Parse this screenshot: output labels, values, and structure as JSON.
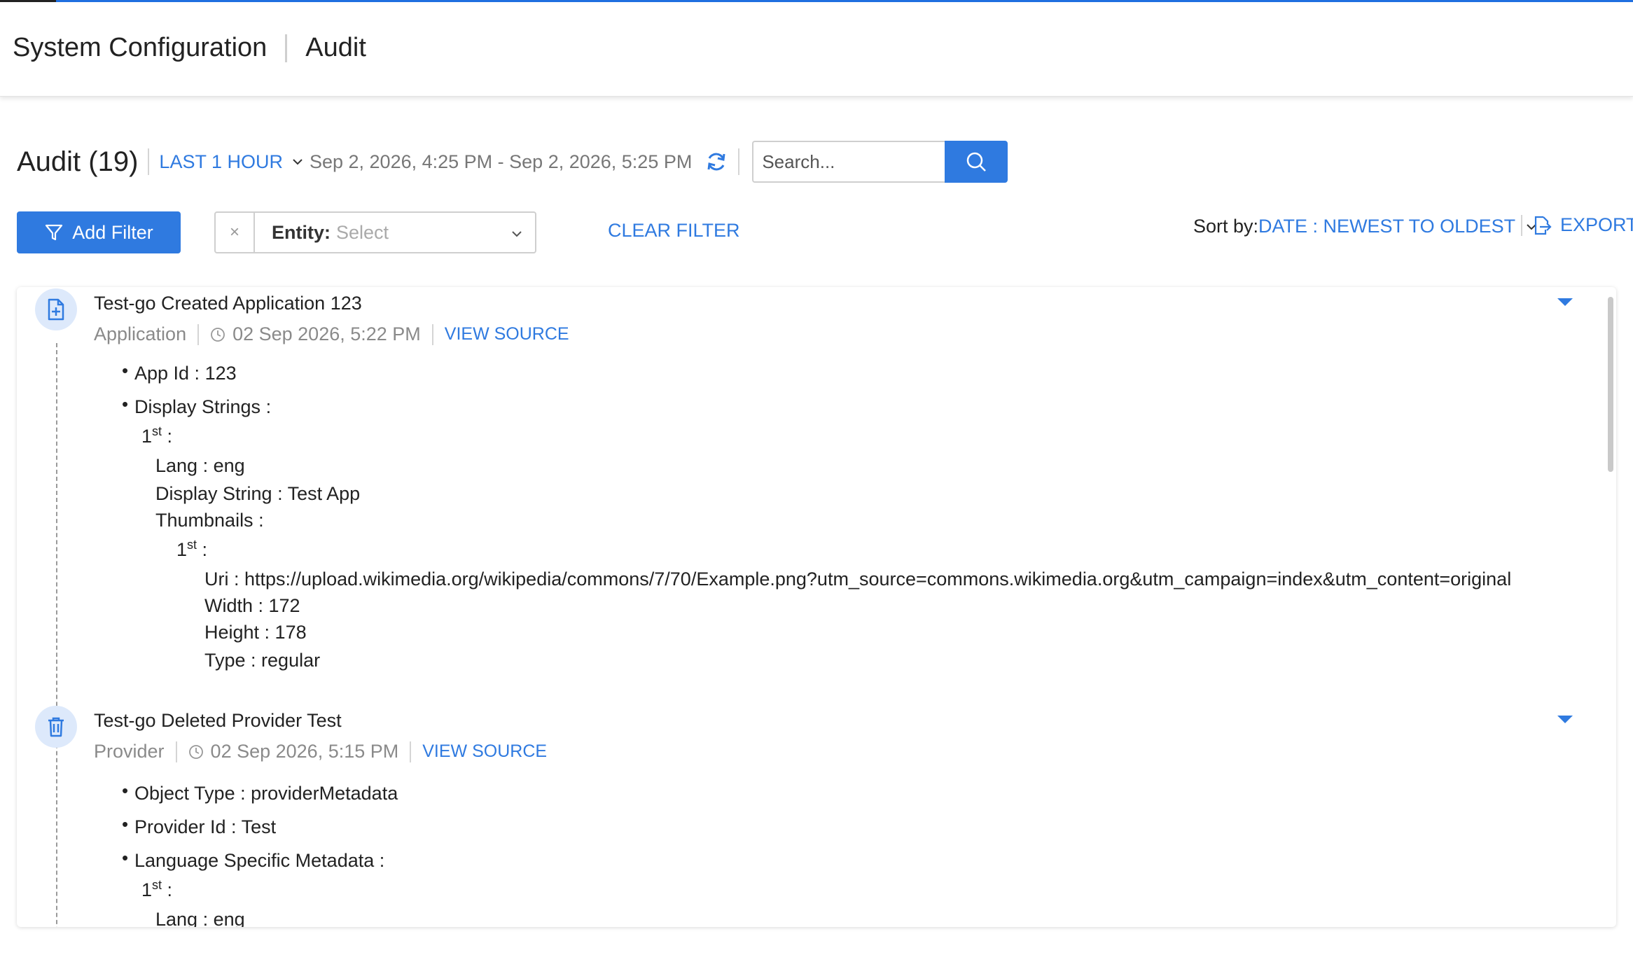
{
  "header": {
    "breadcrumb": [
      "System Configuration",
      "Audit"
    ]
  },
  "toolbar": {
    "title": "Audit (19)",
    "time_range_label": "LAST 1 HOUR",
    "date_range": "Sep 2, 2026, 4:25 PM - Sep 2, 2026, 5:25 PM",
    "search_placeholder": "Search...",
    "add_filter_label": "Add Filter",
    "entity_label": "Entity:",
    "entity_placeholder": "Select",
    "entity_clear": "×",
    "clear_filter_label": "CLEAR FILTER",
    "sort_label": "Sort by:",
    "sort_value": "DATE : NEWEST TO OLDEST",
    "export_label": "EXPORT"
  },
  "colors": {
    "accent": "#2f7ae0",
    "icon_bg": "#dde9fb",
    "muted_text": "#8a8a8a"
  },
  "entries": [
    {
      "icon": "file-plus-icon",
      "title": "Test-go Created Application 123",
      "type": "Application",
      "time": "02 Sep 2026, 5:22 PM",
      "view_source": "VIEW SOURCE",
      "details": {
        "app_id": "App Id : 123",
        "display_strings": "Display Strings :",
        "first": "1",
        "first_sup": "st",
        "first_suffix": " :",
        "lang": "Lang : eng",
        "display_string": "Display String : Test App",
        "thumbnails": "Thumbnails :",
        "thumb_first": "1",
        "thumb_first_sup": "st",
        "thumb_first_suffix": " :",
        "uri": "Uri : https://upload.wikimedia.org/wikipedia/commons/7/70/Example.png?utm_source=commons.wikimedia.org&utm_campaign=index&utm_content=original",
        "width": "Width : 172",
        "height": "Height : 178",
        "type": "Type : regular"
      }
    },
    {
      "icon": "trash-icon",
      "title": "Test-go Deleted Provider Test",
      "type": "Provider",
      "time": "02 Sep 2026, 5:15 PM",
      "view_source": "VIEW SOURCE",
      "details": {
        "object_type": "Object Type : providerMetadata",
        "provider_id": "Provider Id : Test",
        "language_metadata": "Language Specific Metadata :",
        "first": "1",
        "first_sup": "st",
        "first_suffix": " :",
        "lang": "Lang : eng"
      }
    }
  ]
}
